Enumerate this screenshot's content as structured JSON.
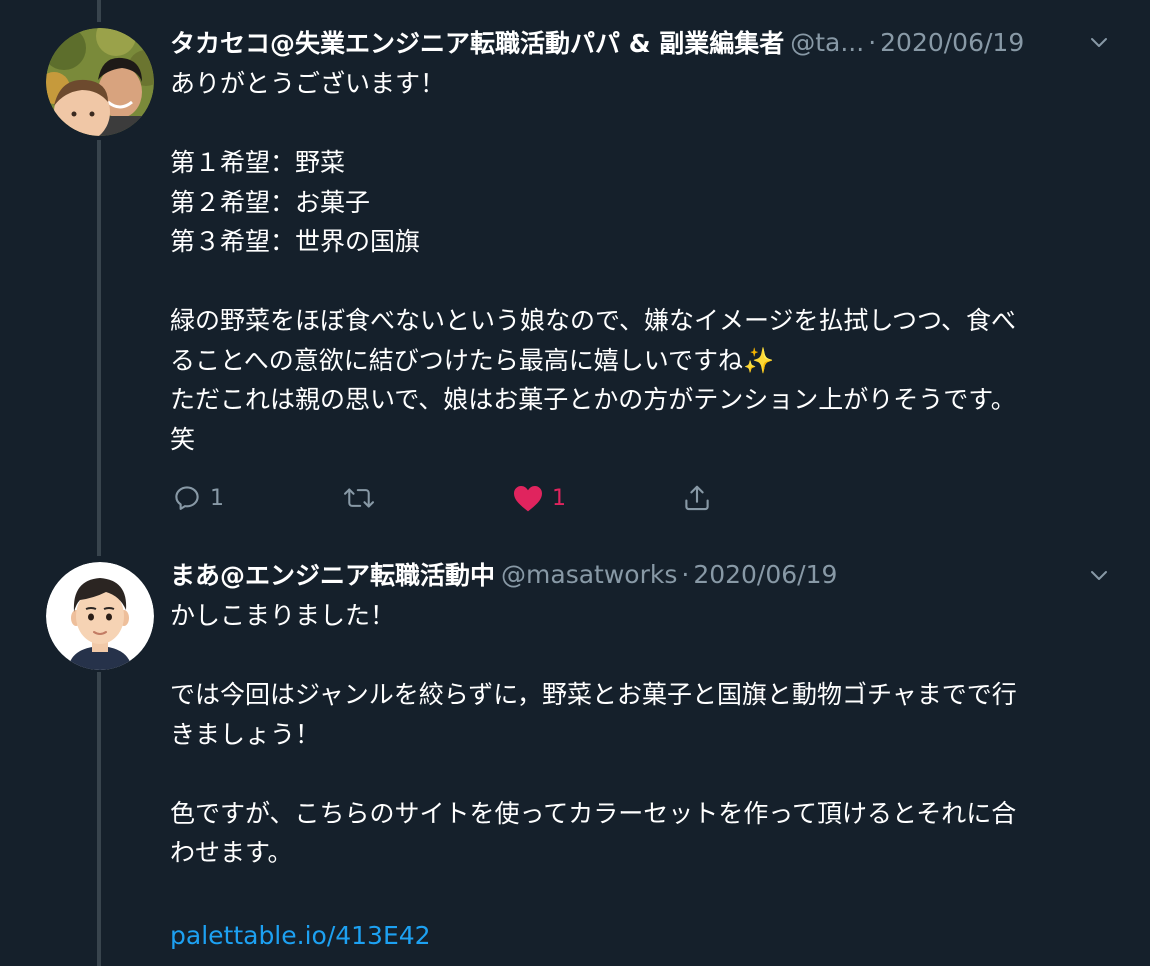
{
  "tweets": [
    {
      "display_name": "タカセコ@失業エンジニア転職活動パパ & 副業編集者",
      "handle": "@ta...",
      "separator": "·",
      "date": "2020/06/19",
      "body": "ありがとうございます！\n\n第１希望：野菜\n第２希望：お菓子\n第３希望：世界の国旗\n\n緑の野菜をほぼ食べないという娘なので、嫌なイメージを払拭しつつ、食べ\nることへの意欲に結びつけたら最高に嬉しいですね✨\nただこれは親の思いで、娘はお菓子とかの方がテンション上がりそうです。\n笑",
      "actions": {
        "reply_count": "1",
        "retweet_count": "",
        "like_count": "1",
        "like_active": true
      }
    },
    {
      "display_name": "まあ@エンジニア転職活動中",
      "handle": "@masatworks",
      "separator": "·",
      "date": "2020/06/19",
      "body": "かしこまりました！\n\nでは今回はジャンルを絞らずに，野菜とお菓子と国旗と動物ゴチャまでで行\nきましょう！\n\n色ですが、こちらのサイトを使ってカラーセットを作って頂けるとそれに合\nわせます。\n",
      "link": "palettable.io/413E42"
    }
  ],
  "colors": {
    "background": "#15202b",
    "thread_line": "#38444d",
    "text_primary": "#ffffff",
    "text_secondary": "#8899a6",
    "link": "#1da1f2",
    "like_active": "#e0245e"
  },
  "icons": {
    "reply": "reply-icon",
    "retweet": "retweet-icon",
    "like": "heart-icon",
    "share": "share-icon",
    "more": "chevron-down-icon"
  }
}
